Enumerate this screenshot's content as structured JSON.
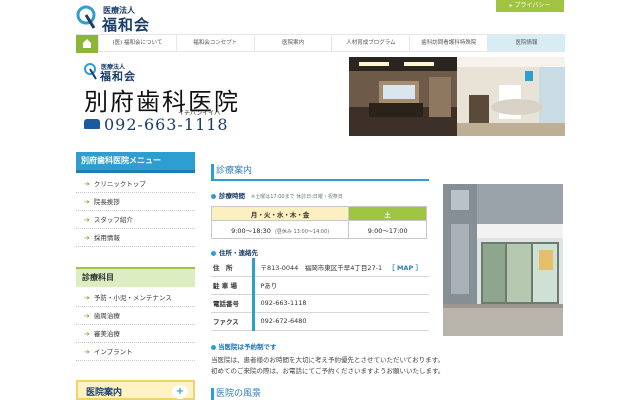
{
  "top": {
    "logo_sub": "医療法人",
    "logo_main": "福和会",
    "privacy_label": "▸ プライバシー"
  },
  "nav": {
    "items": [
      {
        "label": "(医) 福和会について"
      },
      {
        "label": "福和会コンセプト"
      },
      {
        "label": "医院案内"
      },
      {
        "label": "人材育成プログラム"
      },
      {
        "label": "歯科訪問看護科特殊院"
      },
      {
        "label": "医院情報"
      }
    ]
  },
  "header": {
    "logo_sub": "医療法人",
    "logo_main": "福和会",
    "clinic_name": "別府歯科医院",
    "phone": "092-663-1118",
    "phone_reading": "イチバンイイハ"
  },
  "sidebar": {
    "menu_title": "別府歯科医院メニュー",
    "menu_items": [
      {
        "label": "クリニックトップ"
      },
      {
        "label": "院長挨拶"
      },
      {
        "label": "スタッフ紹介"
      },
      {
        "label": "採用情報"
      }
    ],
    "dept_title": "診療科目",
    "dept_items": [
      {
        "label": "予防・小児・メンテナンス"
      },
      {
        "label": "歯周治療"
      },
      {
        "label": "審美治療"
      },
      {
        "label": "インプラント"
      }
    ],
    "banner_label": "医院案内",
    "banner_icon": "+"
  },
  "main": {
    "title": "診療案内",
    "hours": {
      "heading": "診療時間",
      "note": "※土曜は17:00まで 休診日:日曜・祝祭日",
      "weekday_label": "月・火・水・木・金",
      "saturday_label": "土",
      "weekday_hours": "9:00～18:30",
      "lunch": "(昼休み 13:00～14:00)",
      "saturday_hours": "9:00～17:00"
    },
    "contact": {
      "heading": "住所・連絡先",
      "rows": [
        {
          "key": "住　所",
          "value": "〒813-0044　福岡市東区千早4丁目27-1"
        },
        {
          "key": "駐 車 場",
          "value": "Pあり"
        },
        {
          "key": "電話番号",
          "value": "092-663-1118"
        },
        {
          "key": "ファクス",
          "value": "092-672-6480"
        }
      ],
      "map_label": "［ MAP ］"
    },
    "reserve": "当医院は予約制です",
    "desc_lines": [
      "当医院は、患者様のお時間を大切に考え予約優先とさせていただいております。",
      "初めてのご来院の際は、お電話にてご予約くださいますようお願いいたします。"
    ],
    "bottom_title": "医院の風景"
  },
  "colors": {
    "accent_blue": "#2e9ed1",
    "accent_green": "#9fc441",
    "navy": "#1a3d6b"
  }
}
